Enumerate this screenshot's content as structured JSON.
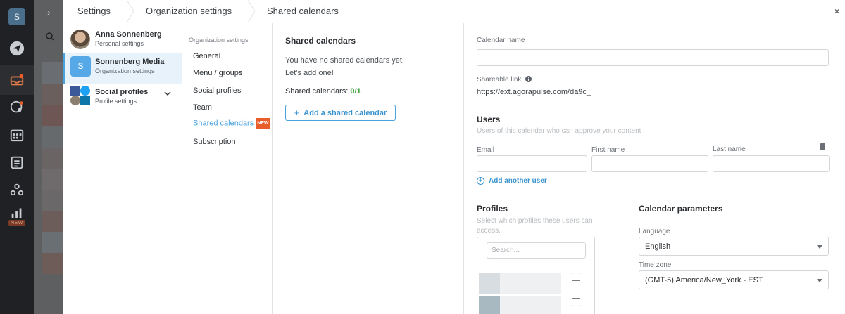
{
  "rail": {
    "workspace_initial": "S",
    "icons": [
      "paper-plane-icon",
      "inbox-icon",
      "listening-icon",
      "calendar-icon",
      "schedule-icon",
      "team-icon",
      "reports-icon"
    ],
    "reports_badge": "NEW"
  },
  "breadcrumb": {
    "items": [
      "Settings",
      "Organization settings",
      "Shared calendars"
    ],
    "close_symbol": "×"
  },
  "accounts": [
    {
      "name": "Anna Sonnenberg",
      "subtitle": "Personal settings"
    },
    {
      "name": "Sonnenberg Media",
      "subtitle": "Organization settings",
      "initial": "S",
      "selected": true
    },
    {
      "name": "Social profiles",
      "subtitle": "Profile settings"
    }
  ],
  "nav": {
    "heading": "Organization settings",
    "items": [
      "General",
      "Menu / groups",
      "Social profiles",
      "Team",
      "Shared calendars",
      "Subscription"
    ],
    "active_index": 4,
    "new_tag": "NEW"
  },
  "shared_list": {
    "title": "Shared calendars",
    "empty_line1": "You have no shared calendars yet.",
    "empty_line2": "Let's add one!",
    "count_label": "Shared calendars:",
    "count_value": "0/1",
    "add_button": "Add a shared calendar"
  },
  "form": {
    "calendar_name_label": "Calendar name",
    "calendar_name_value": "",
    "shareable_link_label": "Shareable link",
    "shareable_link_value": "https://ext.agorapulse.com/da9c_",
    "users_title": "Users",
    "users_desc": "Users of this calendar who can approve your content",
    "email_label": "Email",
    "first_name_label": "First name",
    "last_name_label": "Last name",
    "add_user": "Add another user",
    "profiles_title": "Profiles",
    "profiles_desc": "Select which profiles these users can access.",
    "profiles_search_placeholder": "Search...",
    "params_title": "Calendar parameters",
    "language_label": "Language",
    "language_value": "English",
    "timezone_label": "Time zone",
    "timezone_value": "(GMT-5) America/New_York - EST"
  },
  "colors": {
    "accent": "#4aa3df",
    "new_badge": "#e85d2a",
    "count_green": "#3ba03b"
  }
}
